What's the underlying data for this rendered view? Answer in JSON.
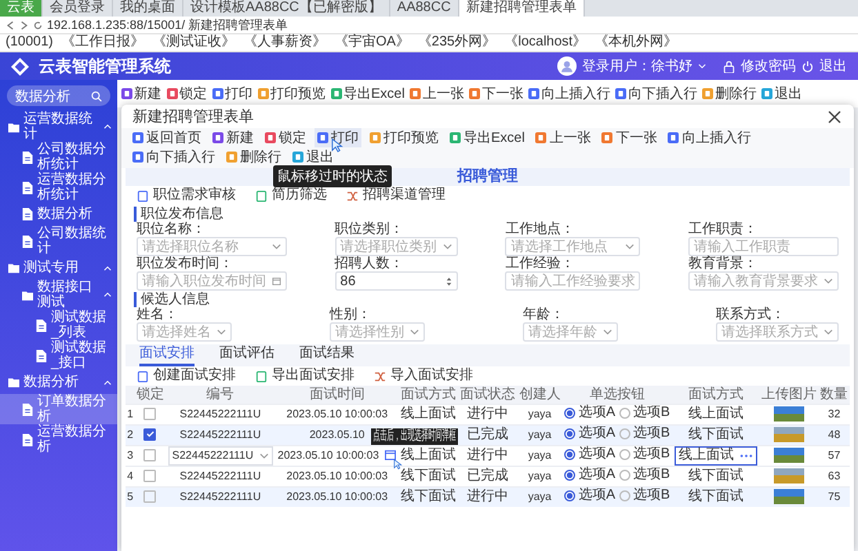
{
  "browser": {
    "tabs": [
      {
        "label": "云表",
        "selected": false
      },
      {
        "label": "会员登录",
        "selected": false
      },
      {
        "label": "我的桌面",
        "selected": false
      },
      {
        "label": "设计模板AA88CC【已解密版】",
        "selected": false
      },
      {
        "label": "AA88CC",
        "selected": false
      },
      {
        "label": "新建招聘管理表单",
        "selected": true
      }
    ],
    "address": "192.168.1.235:88/15001/ 新建招聘管理表单",
    "bookmarks": [
      "(10001)",
      "《工作日报》",
      "《测试证收》",
      "《人事薪资》",
      "《宇宙OA》",
      "《235外网》",
      "《localhost》",
      "《本机外网》"
    ]
  },
  "app": {
    "title": "云表智能管理系统",
    "user": "登录用户：徐书妤",
    "change_password": "修改密码",
    "logout": "退出"
  },
  "sidebar": {
    "search": {
      "value": "数据分析"
    },
    "items": [
      {
        "label": "运营数据统计",
        "expanded": true,
        "selected": false,
        "children": [
          {
            "label": "公司数据分析统计",
            "selected": false
          },
          {
            "label": "运营数据分析统计",
            "selected": false
          },
          {
            "label": "数据分析",
            "selected": false
          },
          {
            "label": "公司数据统计",
            "selected": false
          }
        ]
      },
      {
        "label": "测试专用",
        "expanded": true,
        "selected": false,
        "children": [
          {
            "label": "数据接口测试",
            "expanded": true,
            "selected": false,
            "children": [
              {
                "label": "测试数据_列表",
                "selected": false
              },
              {
                "label": "测试数据_接口",
                "selected": false
              }
            ]
          }
        ]
      },
      {
        "label": "数据分析",
        "expanded": true,
        "selected": false,
        "children": [
          {
            "label": "订单数据分析",
            "selected": true
          },
          {
            "label": "运营数据分析",
            "selected": false
          }
        ]
      }
    ]
  },
  "toolbar": [
    "新建",
    "锁定",
    "打印",
    "打印预览",
    "导出Excel",
    "上一张",
    "下一张",
    "向上插入行",
    "向下插入行",
    "删除行",
    "退出"
  ],
  "dialog": {
    "title": "新建招聘管理表单",
    "toolbar": [
      {
        "label": "返回首页",
        "hovered": false
      },
      {
        "label": "新建",
        "hovered": false
      },
      {
        "label": "锁定",
        "hovered": false
      },
      {
        "label": "打印",
        "hovered": true,
        "tooltip": "鼠标移过时的状态"
      },
      {
        "label": "打印预览",
        "hovered": false
      },
      {
        "label": "导出Excel",
        "hovered": false
      },
      {
        "label": "上一张",
        "hovered": false
      },
      {
        "label": "下一张",
        "hovered": false
      },
      {
        "label": "向上插入行",
        "hovered": false
      },
      {
        "label": "向下插入行",
        "hovered": false
      },
      {
        "label": "删除行",
        "hovered": false
      },
      {
        "label": "退出",
        "hovered": false
      }
    ],
    "heading": "招聘管理",
    "links": [
      "职位需求审核",
      "简历筛选",
      "招聘渠道管理"
    ],
    "sections": [
      {
        "title": "职位发布信息",
        "fields": [
          {
            "label": "职位名称：",
            "placeholder": "请选择职位名称",
            "kind": "select"
          },
          {
            "label": "职位类别：",
            "placeholder": "请选择职位类别",
            "kind": "select"
          },
          {
            "label": "工作地点：",
            "placeholder": "请选择工作地点",
            "kind": "select"
          },
          {
            "label": "工作职责：",
            "placeholder": "请输入工作职责",
            "kind": "text"
          },
          {
            "label": "职位发布时间：",
            "placeholder": "请输入职位发布时间",
            "kind": "date"
          },
          {
            "label": "招聘人数：",
            "value": "86",
            "kind": "number"
          },
          {
            "label": "工作经验：",
            "placeholder": "请输入工作经验要求",
            "kind": "text"
          },
          {
            "label": "教育背景：",
            "placeholder": "请输入教育背景要求",
            "kind": "select"
          }
        ]
      },
      {
        "title": "候选人信息",
        "fields": [
          {
            "label": "姓名：",
            "placeholder": "请选择姓名",
            "kind": "select"
          },
          {
            "label": "性别：",
            "placeholder": "请选择性别",
            "kind": "select"
          },
          {
            "label": "年龄：",
            "placeholder": "请选择年龄",
            "kind": "select"
          },
          {
            "label": "联系方式：",
            "placeholder": "请选择联系方式",
            "kind": "select"
          }
        ]
      }
    ],
    "tabs": [
      {
        "label": "面试安排",
        "selected": true
      },
      {
        "label": "面试评估",
        "selected": false
      },
      {
        "label": "面试结果",
        "selected": false
      }
    ],
    "actions": [
      "创建面试安排",
      "导出面试安排",
      "导入面试安排"
    ],
    "table": {
      "columns": [
        "锁定",
        "编号",
        "面试时间",
        "面试方式",
        "面试状态",
        "创建人",
        "单选按钮",
        "面试方式",
        "上传图片",
        "数量"
      ],
      "rows": [
        {
          "index": "1",
          "locked": false,
          "highlighted": false,
          "editing": false,
          "code": "S22445222111U",
          "time": "2023.05.10 10:00:03",
          "mode": "线上面试",
          "status": "进行中",
          "creator": "yaya",
          "choices": [
            {
              "label": "选项A",
              "selected": true
            },
            {
              "label": "选项B",
              "selected": false
            }
          ],
          "mode_2": "线上面试",
          "quantity": "32"
        },
        {
          "index": "2",
          "locked": true,
          "highlighted": true,
          "editing": false,
          "code": "S22445222111U",
          "time": "2023.05.10",
          "status": "已完成",
          "creator": "yaya",
          "choices": [
            {
              "label": "选项A",
              "selected": true
            },
            {
              "label": "选项B",
              "selected": false
            }
          ],
          "mode_2": "线下面试",
          "quantity": "48"
        },
        {
          "index": "3",
          "locked": false,
          "highlighted": false,
          "editing": true,
          "time_tooltip": "点击后，出现选择时间弹框",
          "code": "S22445222111U",
          "time": "2023.05.10 10:00:03",
          "mode": "线上面试",
          "status": "进行中",
          "creator": "yaya",
          "choices": [
            {
              "label": "选项A",
              "selected": true
            },
            {
              "label": "选项B",
              "selected": false
            }
          ],
          "mode_2": "线上面试",
          "quantity": "57"
        },
        {
          "index": "4",
          "locked": false,
          "highlighted": false,
          "editing": false,
          "code": "S22445222111U",
          "time": "2023.05.10 10:00:03",
          "mode": "线下面试",
          "status": "已完成",
          "creator": "yaya",
          "choices": [
            {
              "label": "选项A",
              "selected": true
            },
            {
              "label": "选项B",
              "selected": false
            }
          ],
          "mode_2": "线下面试",
          "quantity": "63"
        },
        {
          "index": "5",
          "locked": false,
          "highlighted": true,
          "editing": false,
          "code": "S22445222111U",
          "time": "2023.05.10 10:00:03",
          "mode": "线下面试",
          "status": "进行中",
          "creator": "yaya",
          "choices": [
            {
              "label": "选项A",
              "selected": true
            },
            {
              "label": "选项B",
              "selected": false
            }
          ],
          "mode_2": "线下面试",
          "quantity": "75"
        }
      ]
    }
  }
}
